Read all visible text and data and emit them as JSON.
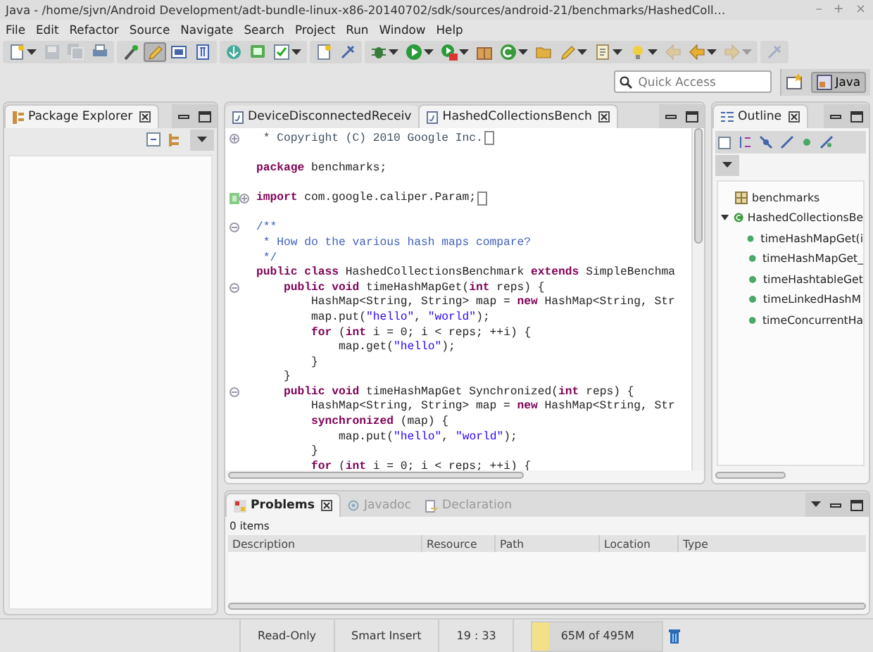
{
  "window": {
    "title": "Java - /home/sjvn/Android Development/adt-bundle-linux-x86-20140702/sdk/sources/android-21/benchmarks/HashedColl…",
    "controls": [
      "–",
      "+",
      "×"
    ]
  },
  "menu": [
    "File",
    "Edit",
    "Refactor",
    "Source",
    "Navigate",
    "Search",
    "Project",
    "Run",
    "Window",
    "Help"
  ],
  "toolbar": [
    [
      {
        "kind": "new-file",
        "disabled": false,
        "pressed": false,
        "dropdown": true
      },
      {
        "kind": "save",
        "disabled": true,
        "pressed": false,
        "dropdown": false
      },
      {
        "kind": "save-all",
        "disabled": true,
        "pressed": false,
        "dropdown": false
      },
      {
        "kind": "print",
        "disabled": false,
        "pressed": false,
        "dropdown": false
      }
    ],
    [
      {
        "kind": "wand",
        "disabled": false,
        "pressed": false,
        "dropdown": false
      },
      {
        "kind": "marker",
        "disabled": false,
        "pressed": true,
        "dropdown": false
      },
      {
        "kind": "window",
        "disabled": false,
        "pressed": false,
        "dropdown": false
      },
      {
        "kind": "pilcrow",
        "disabled": false,
        "pressed": false,
        "dropdown": false
      }
    ],
    [
      {
        "kind": "download",
        "disabled": false,
        "pressed": false,
        "dropdown": false
      },
      {
        "kind": "screen",
        "disabled": false,
        "pressed": false,
        "dropdown": false
      },
      {
        "kind": "check",
        "disabled": false,
        "pressed": false,
        "dropdown": true
      }
    ],
    [
      {
        "kind": "new-project",
        "disabled": false,
        "pressed": false,
        "dropdown": false
      },
      {
        "kind": "pin",
        "disabled": false,
        "pressed": false,
        "dropdown": false
      }
    ],
    [
      {
        "kind": "bug",
        "disabled": false,
        "pressed": false,
        "dropdown": true
      },
      {
        "kind": "play",
        "disabled": false,
        "pressed": false,
        "dropdown": true
      },
      {
        "kind": "play-external",
        "disabled": false,
        "pressed": false,
        "dropdown": true
      },
      {
        "kind": "box",
        "disabled": false,
        "pressed": false,
        "dropdown": false
      },
      {
        "kind": "new-class",
        "disabled": false,
        "pressed": false,
        "dropdown": true
      },
      {
        "kind": "folder",
        "disabled": false,
        "pressed": false,
        "dropdown": false
      },
      {
        "kind": "pencil",
        "disabled": false,
        "pressed": false,
        "dropdown": true
      },
      {
        "kind": "clipboard",
        "disabled": false,
        "pressed": false,
        "dropdown": true
      },
      {
        "kind": "bulb",
        "disabled": false,
        "pressed": false,
        "dropdown": true
      },
      {
        "kind": "back",
        "disabled": true,
        "pressed": false,
        "dropdown": false
      },
      {
        "kind": "prev",
        "disabled": false,
        "pressed": false,
        "dropdown": true
      },
      {
        "kind": "forward",
        "disabled": true,
        "pressed": false,
        "dropdown": true
      }
    ],
    [
      {
        "kind": "pin",
        "disabled": true,
        "pressed": false,
        "dropdown": false
      }
    ]
  ],
  "quick_access": {
    "placeholder": "Quick Access"
  },
  "perspectives": [
    {
      "label": "Java",
      "selected": true
    }
  ],
  "package_explorer": {
    "title": "Package Explorer"
  },
  "editor": {
    "tabs": [
      {
        "label": "DeviceDisconnectedReceiv",
        "selected": false
      },
      {
        "label": "HashedCollectionsBench",
        "selected": true
      }
    ],
    "lines": [
      {
        "kind": "fold-closed",
        "segments": [
          {
            "text": " * Copyright (C) 2010 Google Inc.",
            "kind": "comment"
          }
        ]
      },
      {
        "kind": "plain"
      },
      {
        "kind": "plain",
        "segments": [
          {
            "text": "package",
            "kind": "keyword"
          },
          {
            "text": " benchmarks;",
            "kind": "plain"
          }
        ]
      },
      {
        "kind": "plain"
      },
      {
        "kind": "quickfix",
        "segments": [
          {
            "text": "import",
            "kind": "keyword"
          },
          {
            "text": " com.google.caliper.Param;",
            "kind": "plain"
          }
        ]
      },
      {
        "kind": "plain"
      },
      {
        "kind": "fold-open",
        "segments": [
          {
            "text": "/**",
            "kind": "javadoc"
          }
        ]
      },
      {
        "kind": "plain",
        "segments": [
          {
            "text": " * How do the various hash maps compare?",
            "kind": "javadoc"
          }
        ]
      },
      {
        "kind": "plain",
        "segments": [
          {
            "text": " */",
            "kind": "javadoc"
          }
        ]
      },
      {
        "kind": "plain",
        "segments": [
          {
            "text": "public class",
            "kind": "keyword"
          },
          {
            "text": " HashedCollectionsBenchmark ",
            "kind": "plain"
          },
          {
            "text": "extends",
            "kind": "keyword"
          },
          {
            "text": " SimpleBenchma",
            "kind": "plain"
          }
        ]
      },
      {
        "kind": "fold-open",
        "segments": [
          {
            "text": "    public void",
            "kind": "keyword"
          },
          {
            "text": " timeHashMapGet(",
            "kind": "plain"
          },
          {
            "text": "int",
            "kind": "keyword"
          },
          {
            "text": " reps) {",
            "kind": "plain"
          }
        ]
      },
      {
        "kind": "plain",
        "segments": [
          {
            "text": "        HashMap<String, String> map = ",
            "kind": "plain"
          },
          {
            "text": "new",
            "kind": "keyword"
          },
          {
            "text": " HashMap<String, Str",
            "kind": "plain"
          }
        ]
      },
      {
        "kind": "plain",
        "segments": [
          {
            "text": "        map.put(",
            "kind": "plain"
          },
          {
            "text": "\"hello\"",
            "kind": "string"
          },
          {
            "text": ", ",
            "kind": "plain"
          },
          {
            "text": "\"world\"",
            "kind": "string"
          },
          {
            "text": ");",
            "kind": "plain"
          }
        ]
      },
      {
        "kind": "plain",
        "segments": [
          {
            "text": "        for",
            "kind": "keyword"
          },
          {
            "text": " (",
            "kind": "plain"
          },
          {
            "text": "int",
            "kind": "keyword"
          },
          {
            "text": " i = 0; i < reps; ++i) {",
            "kind": "plain"
          }
        ]
      },
      {
        "kind": "plain",
        "segments": [
          {
            "text": "            map.get(",
            "kind": "plain"
          },
          {
            "text": "\"hello\"",
            "kind": "string"
          },
          {
            "text": ");",
            "kind": "plain"
          }
        ]
      },
      {
        "kind": "plain",
        "segments": [
          {
            "text": "        }",
            "kind": "plain"
          }
        ]
      },
      {
        "kind": "plain",
        "segments": [
          {
            "text": "    }",
            "kind": "plain"
          }
        ]
      },
      {
        "kind": "fold-open",
        "segments": [
          {
            "text": "    public void",
            "kind": "keyword"
          },
          {
            "text": " timeHashMapGet Synchronized(",
            "kind": "plain"
          },
          {
            "text": "int",
            "kind": "keyword"
          },
          {
            "text": " reps) {",
            "kind": "plain"
          }
        ]
      },
      {
        "kind": "plain",
        "segments": [
          {
            "text": "        HashMap<String, String> map = ",
            "kind": "plain"
          },
          {
            "text": "new",
            "kind": "keyword"
          },
          {
            "text": " HashMap<String, Str",
            "kind": "plain"
          }
        ]
      },
      {
        "kind": "plain",
        "segments": [
          {
            "text": "        synchronized",
            "kind": "keyword"
          },
          {
            "text": " (map) {",
            "kind": "plain"
          }
        ]
      },
      {
        "kind": "plain",
        "segments": [
          {
            "text": "            map.put(",
            "kind": "plain"
          },
          {
            "text": "\"hello\"",
            "kind": "string"
          },
          {
            "text": ", ",
            "kind": "plain"
          },
          {
            "text": "\"world\"",
            "kind": "string"
          },
          {
            "text": ");",
            "kind": "plain"
          }
        ]
      },
      {
        "kind": "plain",
        "segments": [
          {
            "text": "        }",
            "kind": "plain"
          }
        ]
      },
      {
        "kind": "plain",
        "segments": [
          {
            "text": "        for",
            "kind": "keyword"
          },
          {
            "text": " (",
            "kind": "plain"
          },
          {
            "text": "int",
            "kind": "keyword"
          },
          {
            "text": " i = 0; i < reps; ++i) {",
            "kind": "plain"
          }
        ]
      }
    ]
  },
  "outline": {
    "title": "Outline",
    "tree": [
      {
        "label": "benchmarks",
        "kind": "package"
      },
      {
        "label": "HashedCollectionsBe",
        "kind": "class",
        "expanded": true,
        "children": [
          {
            "label": "timeHashMapGet(i",
            "kind": "method"
          },
          {
            "label": "timeHashMapGet_",
            "kind": "method"
          },
          {
            "label": "timeHashtableGet",
            "kind": "method"
          },
          {
            "label": "timeLinkedHashM",
            "kind": "method"
          },
          {
            "label": "timeConcurrentHa",
            "kind": "method"
          }
        ]
      }
    ]
  },
  "problems": {
    "tabs": [
      {
        "label": "Problems",
        "selected": true
      },
      {
        "label": "Javadoc",
        "selected": false
      },
      {
        "label": "Declaration",
        "selected": false
      }
    ],
    "count": "0 items",
    "columns": [
      "Description",
      "Resource",
      "Path",
      "Location",
      "Type"
    ]
  },
  "status_bar": {
    "fields": [
      "Read-Only",
      "Smart Insert",
      "19 : 33"
    ],
    "heap": {
      "label": "65M of 495M",
      "level": 0.13
    }
  }
}
